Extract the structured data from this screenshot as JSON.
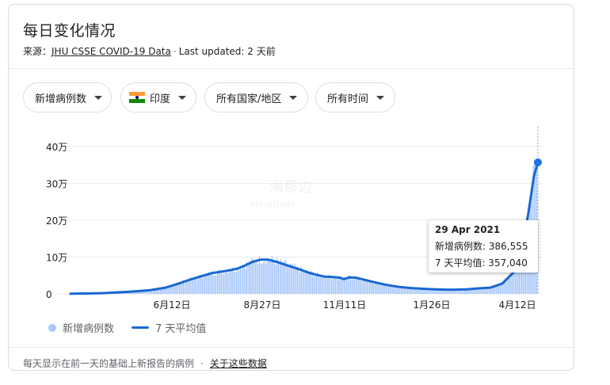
{
  "header": {
    "title": "每日变化情况",
    "source_prefix": "来源：",
    "source_link": "JHU CSSE COVID-19 Data",
    "separator": "·",
    "last_updated": "Last updated: 2 天前"
  },
  "filters": [
    {
      "label": "新增病例数"
    },
    {
      "label": "印度",
      "flag": "india-flag"
    },
    {
      "label": "所有国家/地区"
    },
    {
      "label": "所有时间"
    }
  ],
  "chart_data": {
    "type": "bar",
    "y_ticks": [
      "40万",
      "30万",
      "20万",
      "10万",
      "0"
    ],
    "y_tick_values": [
      400000,
      300000,
      200000,
      100000,
      0
    ],
    "ylim": [
      0,
      420000
    ],
    "x_ticks": [
      "6月12日",
      "8月27日",
      "11月11日",
      "1月26日",
      "4月12日"
    ],
    "grid": true,
    "series": [
      {
        "name": "新增病例数",
        "kind": "bar",
        "color": "#a8c7fa"
      },
      {
        "name": "7 天平均值",
        "kind": "line",
        "color": "#1967d2"
      }
    ],
    "avg_points": [
      [
        0,
        500
      ],
      [
        40,
        2000
      ],
      [
        75,
        6000
      ],
      [
        100,
        10000
      ],
      [
        120,
        17000
      ],
      [
        135,
        27000
      ],
      [
        150,
        38000
      ],
      [
        165,
        48000
      ],
      [
        180,
        57000
      ],
      [
        195,
        62000
      ],
      [
        210,
        68000
      ],
      [
        220,
        77000
      ],
      [
        230,
        87000
      ],
      [
        240,
        93000
      ],
      [
        250,
        93000
      ],
      [
        260,
        87000
      ],
      [
        270,
        80000
      ],
      [
        280,
        73000
      ],
      [
        290,
        66000
      ],
      [
        300,
        58000
      ],
      [
        310,
        52000
      ],
      [
        320,
        47000
      ],
      [
        330,
        46000
      ],
      [
        340,
        44000
      ],
      [
        345,
        40000
      ],
      [
        352,
        45000
      ],
      [
        360,
        44000
      ],
      [
        370,
        39000
      ],
      [
        385,
        31000
      ],
      [
        400,
        24000
      ],
      [
        415,
        19000
      ],
      [
        430,
        16000
      ],
      [
        445,
        14000
      ],
      [
        460,
        12500
      ],
      [
        480,
        11500
      ],
      [
        500,
        12500
      ],
      [
        515,
        15000
      ],
      [
        530,
        17000
      ],
      [
        545,
        28000
      ],
      [
        560,
        60000
      ],
      [
        570,
        125000
      ],
      [
        578,
        220000
      ],
      [
        585,
        320000
      ],
      [
        590,
        357040
      ]
    ],
    "highlight": {
      "date": "29 Apr 2021",
      "new_cases_label": "新增病例数: 386,555",
      "avg_label": "7 天平均值: 357,040",
      "new_cases": 386555,
      "avg": 357040
    }
  },
  "legend": {
    "bars_label": "新增病例数",
    "line_label": "7 天平均值"
  },
  "watermark": {
    "line1": "海那边",
    "line2": "Hinabian"
  },
  "footer": {
    "note": "每天显示在前一天的基础上新报告的病例",
    "separator": "·",
    "about_link": "关于这些数据"
  }
}
